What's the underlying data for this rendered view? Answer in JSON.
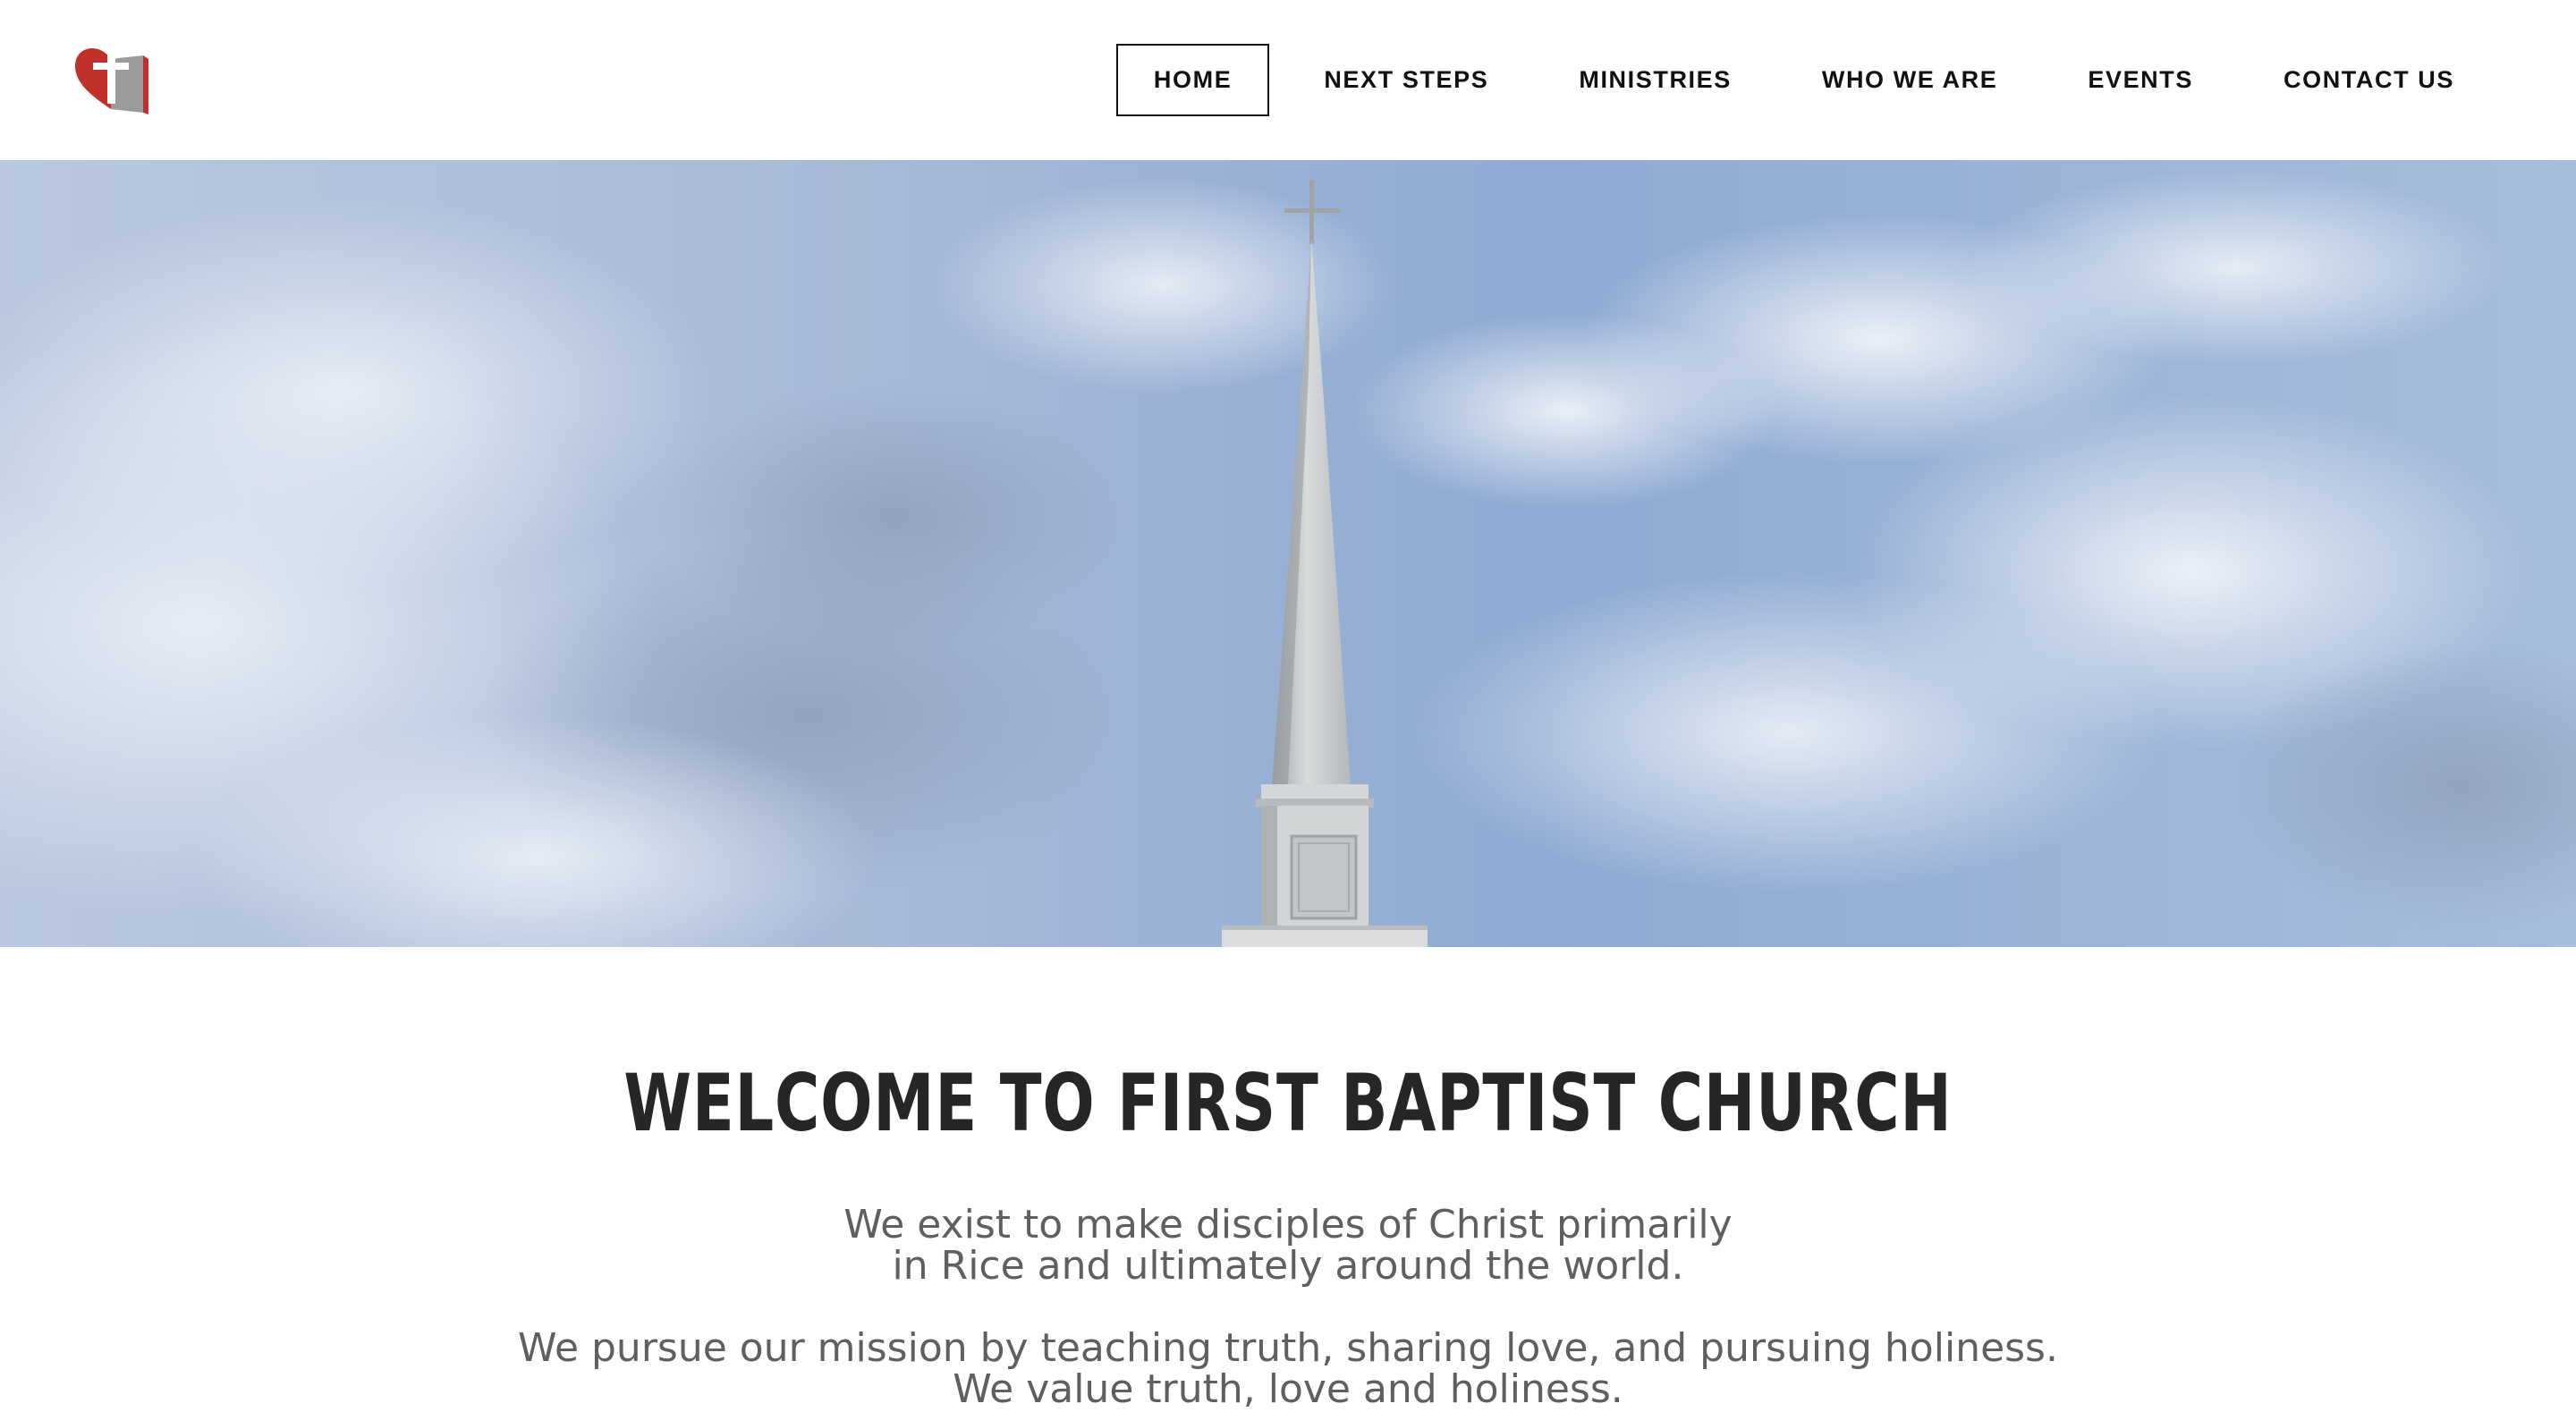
{
  "header": {
    "logo_icon": "heart-cross-bible-logo",
    "nav": [
      {
        "label": "HOME",
        "active": true
      },
      {
        "label": "NEXT STEPS",
        "active": false
      },
      {
        "label": "MINISTRIES",
        "active": false
      },
      {
        "label": "WHO WE ARE",
        "active": false
      },
      {
        "label": "EVENTS",
        "active": false
      },
      {
        "label": "CONTACT US",
        "active": false
      }
    ]
  },
  "hero": {
    "image": "church-steeple-sky-photo"
  },
  "welcome": {
    "title": "WELCOME TO FIRST BAPTIST CHURCH",
    "lines": [
      "We exist to make disciples of Christ primarily",
      "in Rice and ultimately around the world.",
      "We pursue our mission by teaching truth, sharing love, and pursuing holiness.",
      "We value truth, love and holiness."
    ]
  },
  "colors": {
    "logo_red": "#c0312c",
    "logo_gray": "#8a8a8a",
    "title_text": "#262626",
    "body_text": "#5f5f5f",
    "sky": "#9fb5d6"
  }
}
